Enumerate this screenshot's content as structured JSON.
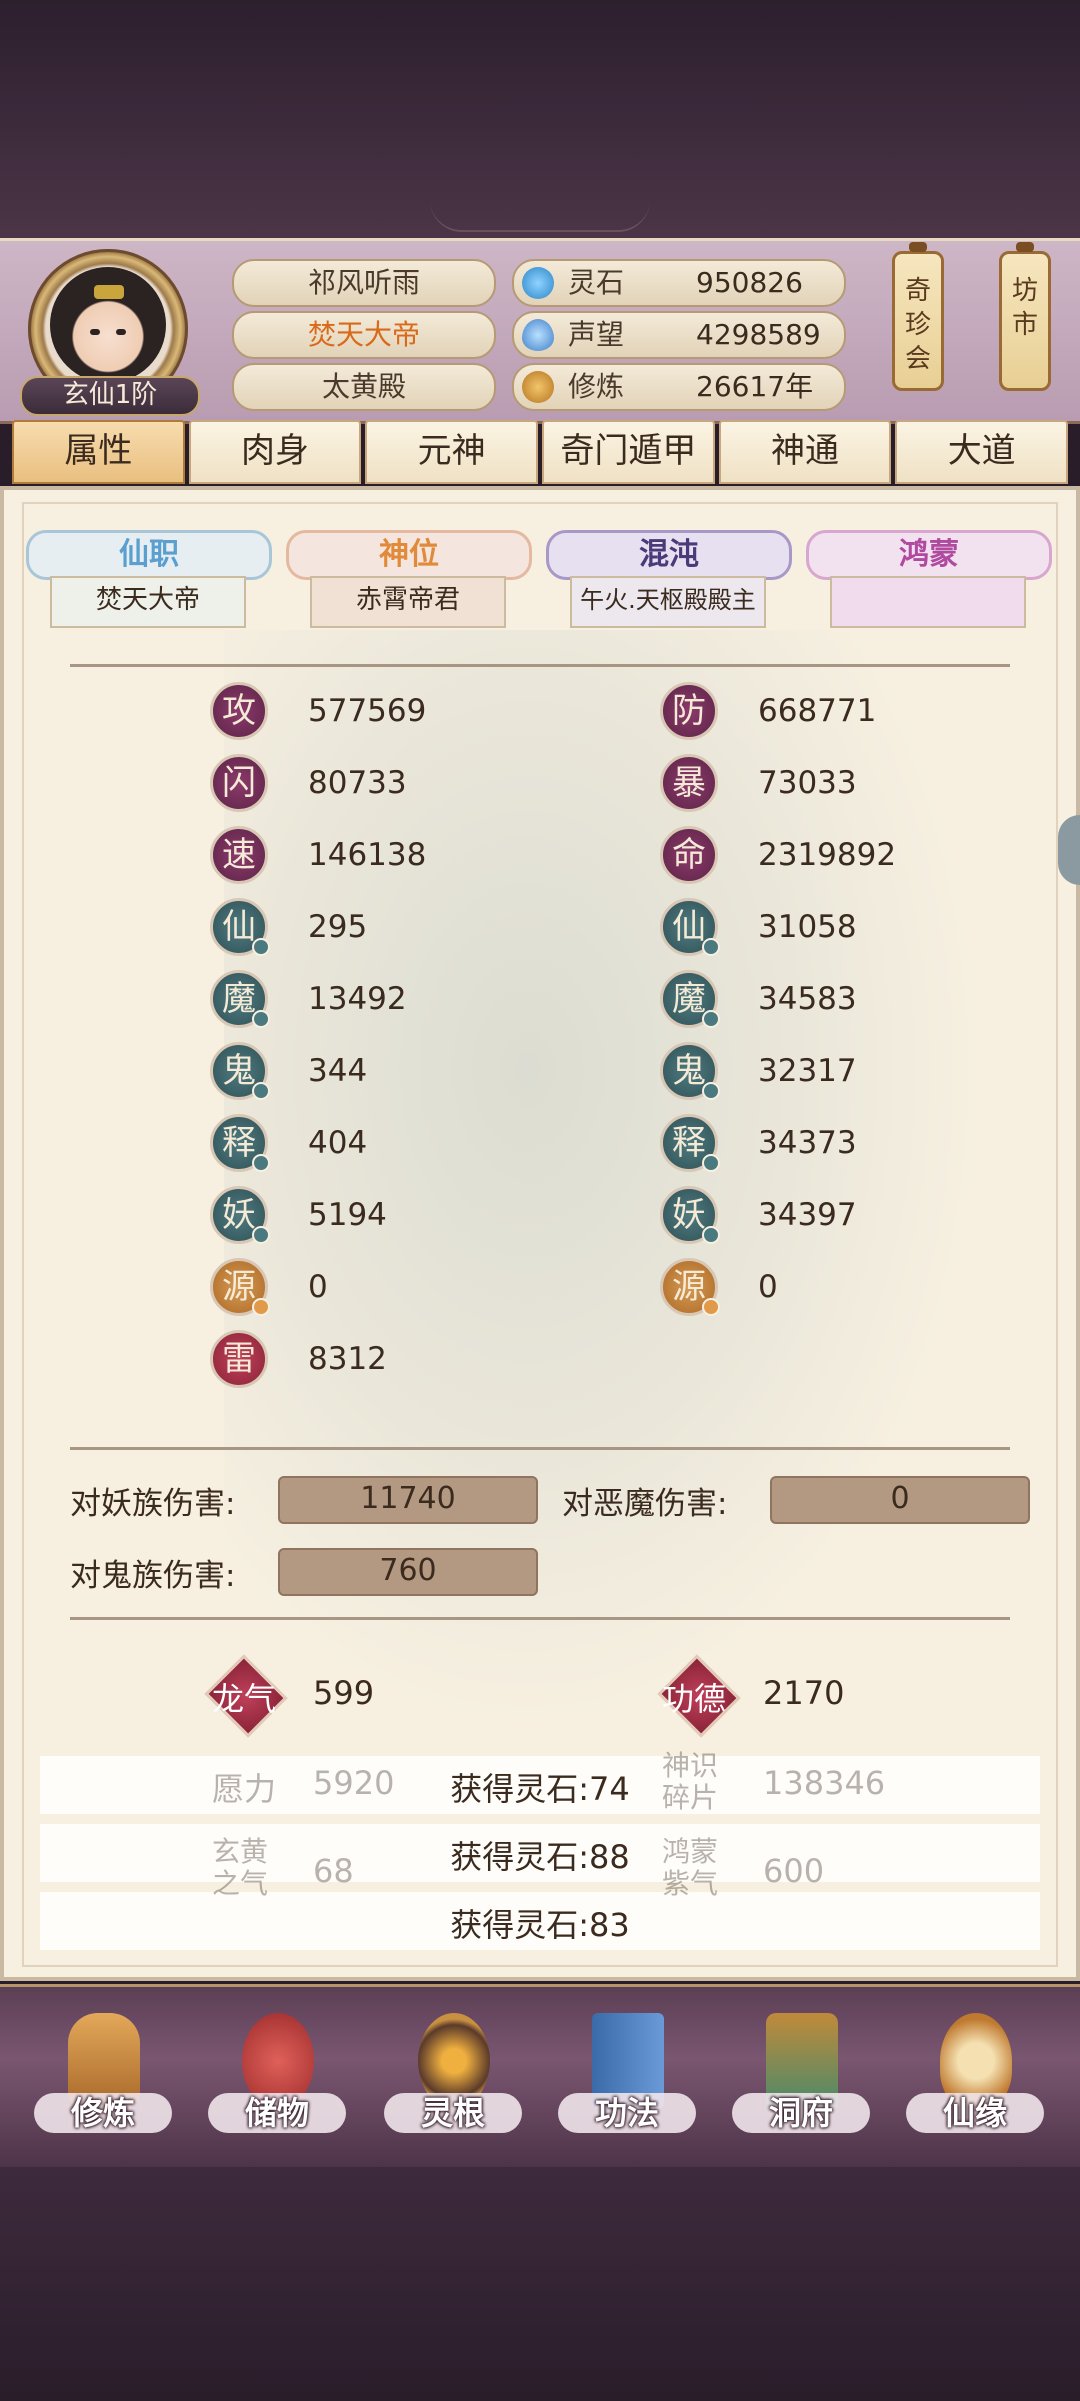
{
  "header": {
    "rank": "玄仙1阶",
    "names": [
      "祁风听雨",
      "焚天大帝",
      "太黄殿"
    ],
    "resources": [
      {
        "label": "灵石",
        "value": "950826",
        "icon": "spirit-stone-icon",
        "color": "#3aa0e0"
      },
      {
        "label": "声望",
        "value": "4298589",
        "icon": "prestige-icon",
        "color": "#4a8fd0"
      },
      {
        "label": "修炼",
        "value": "26617年",
        "icon": "cultivation-icon",
        "color": "#c98a2e"
      }
    ],
    "lanterns": [
      "奇珍会",
      "坊市"
    ]
  },
  "tabs": [
    "属性",
    "肉身",
    "元神",
    "奇门遁甲",
    "神通",
    "大道"
  ],
  "categories": [
    {
      "title": "仙职",
      "value": "焚天大帝",
      "color": "#5a9fd0"
    },
    {
      "title": "神位",
      "value": "赤霄帝君",
      "color": "#e08a3a"
    },
    {
      "title": "混沌",
      "value": "午火.天枢殿殿主",
      "color": "#6a5aa8"
    },
    {
      "title": "鸿蒙",
      "value": "",
      "color": "#b04aa0"
    }
  ],
  "stats_left": [
    {
      "label": "攻",
      "value": "577569"
    },
    {
      "label": "闪",
      "value": "80733"
    },
    {
      "label": "速",
      "value": "146138"
    },
    {
      "label": "仙",
      "value": "295"
    },
    {
      "label": "魔",
      "value": "13492"
    },
    {
      "label": "鬼",
      "value": "344"
    },
    {
      "label": "释",
      "value": "404"
    },
    {
      "label": "妖",
      "value": "5194"
    },
    {
      "label": "源",
      "value": "0"
    },
    {
      "label": "雷",
      "value": "8312"
    }
  ],
  "stats_right": [
    {
      "label": "防",
      "value": "668771"
    },
    {
      "label": "暴",
      "value": "73033"
    },
    {
      "label": "命",
      "value": "2319892"
    },
    {
      "label": "仙",
      "value": "31058"
    },
    {
      "label": "魔",
      "value": "34583"
    },
    {
      "label": "鬼",
      "value": "32317"
    },
    {
      "label": "释",
      "value": "34373"
    },
    {
      "label": "妖",
      "value": "34397"
    },
    {
      "label": "源",
      "value": "0"
    }
  ],
  "damage": [
    {
      "label": "对妖族伤害:",
      "value": "11740"
    },
    {
      "label": "对恶魔伤害:",
      "value": "0"
    },
    {
      "label": "对鬼族伤害:",
      "value": "760"
    }
  ],
  "extras": [
    {
      "label": "龙气",
      "value": "599"
    },
    {
      "label": "功德",
      "value": "2170"
    },
    {
      "label": "愿力",
      "value": "5920"
    },
    {
      "label": "神识碎片",
      "value": "138346"
    },
    {
      "label": "玄黄之气",
      "value": "68"
    },
    {
      "label": "鸿蒙紫气",
      "value": "600"
    }
  ],
  "toasts": [
    "获得灵石:74",
    "获得灵石:88",
    "获得灵石:83"
  ],
  "bottom_nav": [
    "修炼",
    "储物",
    "灵根",
    "功法",
    "洞府",
    "仙缘"
  ]
}
